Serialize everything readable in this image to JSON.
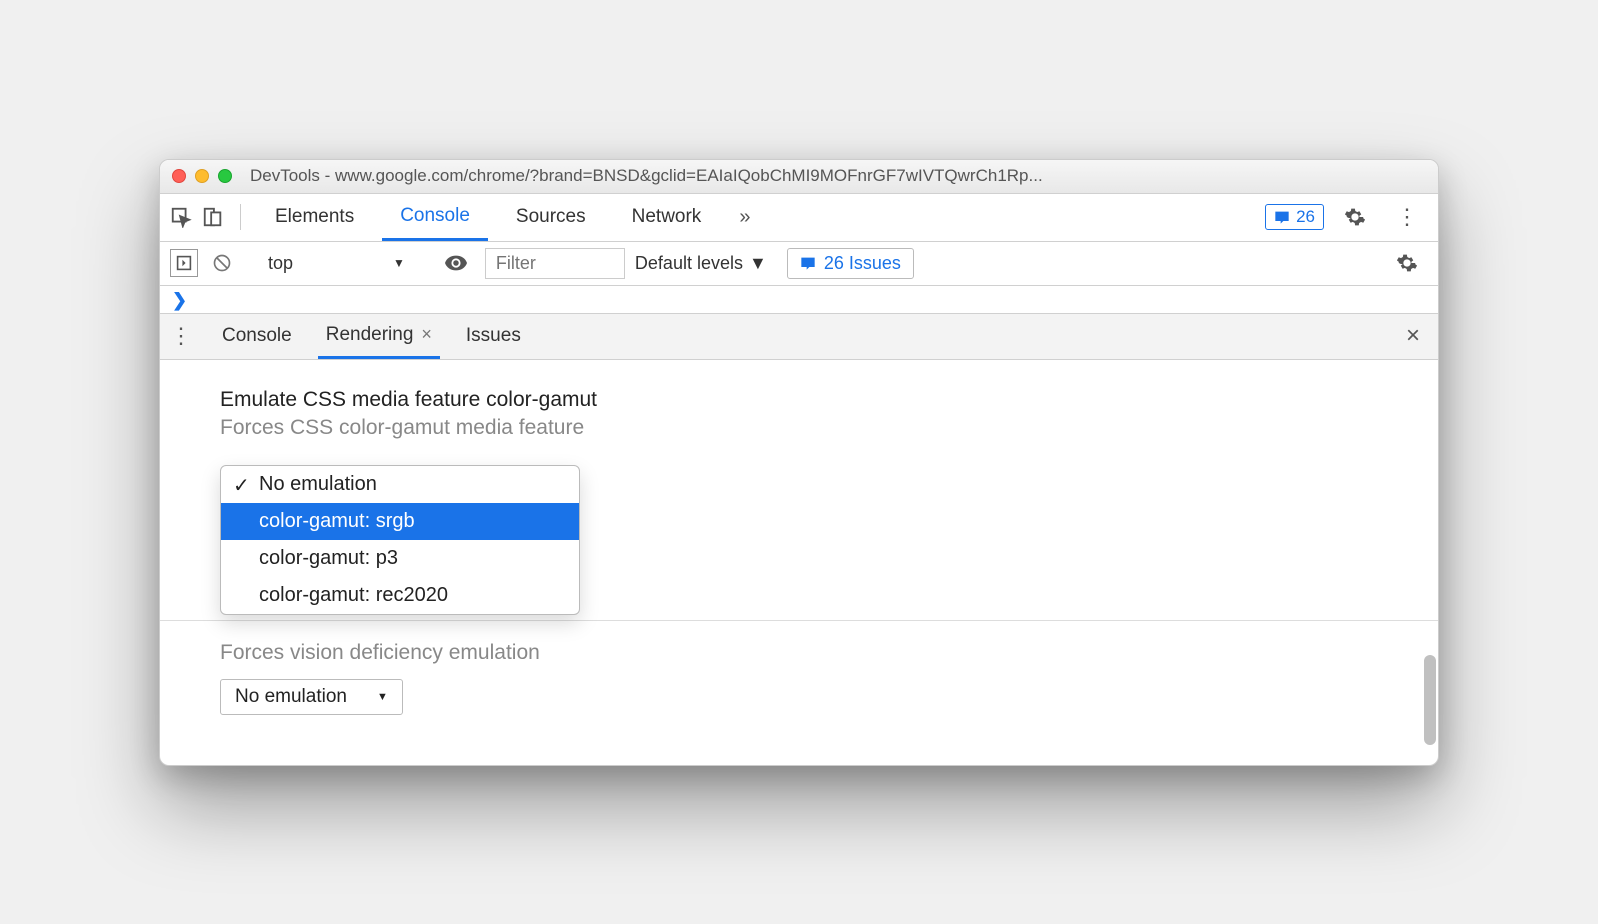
{
  "window": {
    "title": "DevTools - www.google.com/chrome/?brand=BNSD&gclid=EAIaIQobChMI9MOFnrGF7wIVTQwrCh1Rp..."
  },
  "tabs": {
    "items": [
      "Elements",
      "Console",
      "Sources",
      "Network"
    ],
    "active": "Console",
    "overflow": "»"
  },
  "badge": {
    "count": "26"
  },
  "console": {
    "context": "top",
    "filter_placeholder": "Filter",
    "levels": "Default levels",
    "issues": "26 Issues",
    "prompt": "❯"
  },
  "drawer": {
    "tabs": [
      "Console",
      "Rendering",
      "Issues"
    ],
    "active": "Rendering"
  },
  "rendering": {
    "section_title": "Emulate CSS media feature color-gamut",
    "section_desc": "Forces CSS color-gamut media feature",
    "dropdown": {
      "checked": "No emulation",
      "highlighted": "color-gamut: srgb",
      "options": [
        "No emulation",
        "color-gamut: srgb",
        "color-gamut: p3",
        "color-gamut: rec2020"
      ]
    },
    "obscured_desc": "Forces vision deficiency emulation",
    "second_select": "No emulation"
  }
}
